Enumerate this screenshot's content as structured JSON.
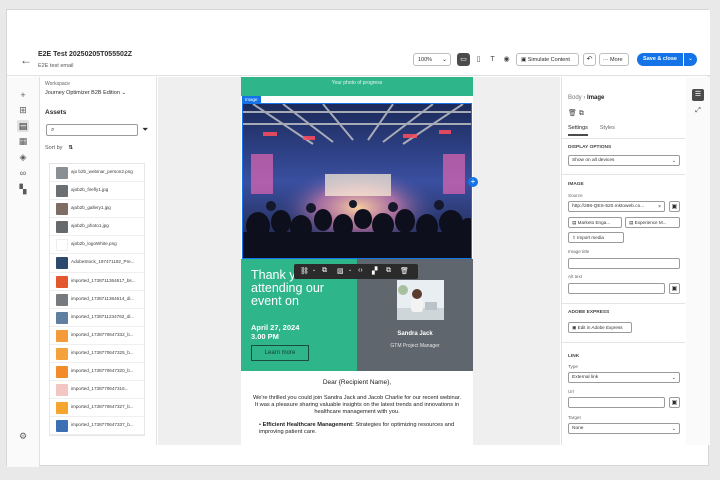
{
  "header": {
    "back_icon": "arrow-left-icon",
    "title": "E2E Test 20250205T055502Z",
    "subtitle": "E2E test email",
    "zoom": "100%",
    "simulate_label": "Simulate Content",
    "more_label": "More",
    "save_label": "Save & close"
  },
  "left_rail": {
    "icons": [
      "plus-icon",
      "grid-icon",
      "assets-icon",
      "fragments-icon",
      "layers-icon",
      "link-icon",
      "components-icon",
      "settings-icon"
    ]
  },
  "assets_panel": {
    "workspace_label": "Workspace",
    "workspace_value": "Journey Optimizer B2B Edition",
    "heading": "Assets",
    "search_placeholder": "",
    "sort_label": "Sort by",
    "sort_value": "⇅",
    "items": [
      {
        "name": "ajo b2b_webinar_person2.png",
        "color": "#8a8f93"
      },
      {
        "name": "ajob2b_firefly1.jpg",
        "color": "#6b6f72"
      },
      {
        "name": "ajob2b_gallery1.jpg",
        "color": "#7d6d63"
      },
      {
        "name": "ajob2b_photo1.jpg",
        "color": "#676a6d"
      },
      {
        "name": "ajob2b_logoWhite.png",
        "color": "#ffffff"
      },
      {
        "name": "AdobeStock_197471192_Pre...",
        "color": "#2d4a6d"
      },
      {
        "name": "imported_1738711364617_bs...",
        "color": "#e4572e"
      },
      {
        "name": "imported_1738711364614_di...",
        "color": "#777b7f"
      },
      {
        "name": "imported_1738711234762_di...",
        "color": "#5e7fa0"
      },
      {
        "name": "imported_1738770647332_b...",
        "color": "#f29b38"
      },
      {
        "name": "imported_1738770647325_b...",
        "color": "#f6a23c"
      },
      {
        "name": "imported_1738770647320_b...",
        "color": "#f28c28"
      },
      {
        "name": "imported_1738770647316...",
        "color": "#f3c6c4"
      },
      {
        "name": "imported_1738770647327_b...",
        "color": "#f4a52e"
      },
      {
        "name": "imported_1738770647337_b...",
        "color": "#3d6fb5"
      }
    ]
  },
  "email": {
    "top_strip": "Your photo of progress",
    "image_tag": "Image",
    "thank_you": "Thank you for attending our event on",
    "date_line1": "April 27, 2024",
    "date_line2": "3.00 PM",
    "learn_more": "Learn more",
    "speaker_name": "Sandra Jack",
    "speaker_title": "GTM Project Manager",
    "greeting": "Dear {Recipient Name},",
    "paragraph": "We're thrilled you could join Sandra Jack and Jacob Charlie for our recent webinar. It was a pleasure sharing valuable insights on the latest trends and innovations in healthcare management with you.",
    "bullet_bold": "Efficient Healthcare Management:",
    "bullet_text": " Strategies for optimizing resources and improving patient care."
  },
  "right_panel": {
    "breadcrumb_parent": "Body",
    "breadcrumb_current": "Image",
    "tab_settings": "Settings",
    "tab_styles": "Styles",
    "display_section": "DISPLAY OPTIONS",
    "display_value": "Show on all devices",
    "image_section": "IMAGE",
    "source_label": "Source",
    "source_value": "http://288-QES-520.mktoweb.co...",
    "marketo_btn": "Marketo Enga...",
    "experience_btn": "Experience M...",
    "import_btn": "Import media",
    "image_title_label": "Image title",
    "alt_text_label": "Alt text",
    "adobe_express_section": "ADOBE EXPRESS",
    "edit_express_btn": "Edit in Adobe Express",
    "link_section": "LINK",
    "type_label": "Type",
    "type_value": "External link",
    "url_label": "Url",
    "target_label": "Target",
    "target_value": "None"
  }
}
